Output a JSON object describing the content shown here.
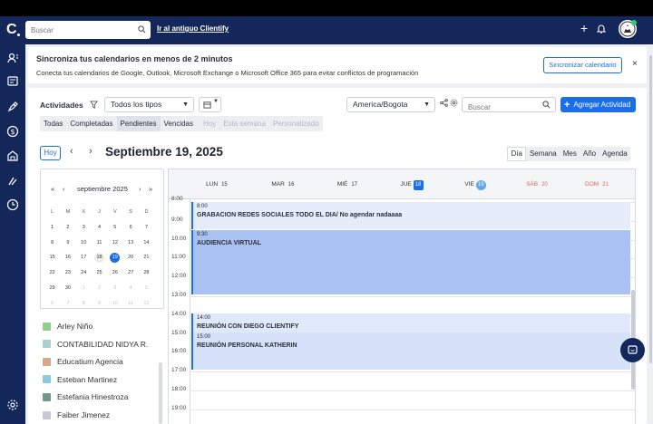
{
  "topnav": {
    "search_placeholder": "Buscar",
    "old_link": "Ir al antiguo Clientify"
  },
  "banner": {
    "title": "Sincroniza tus calendarios en menos de 2 minutos",
    "subtitle": "Conecta tus calendarios de Google, Outlook, Microsoft Exchange o Microsoft Office 365 para evitar conflictos de programación",
    "sync_label": "Sincronizar calendario",
    "close_label": "×"
  },
  "toolbar": {
    "activities_label": "Actividades",
    "types_value": "Todos los tipos",
    "tabs": [
      "Todas",
      "Completadas",
      "Pendientes",
      "Vencidas",
      "Hoy",
      "Esta semana",
      "Personalizado"
    ],
    "timezone_value": "America/Bogota",
    "search_placeholder": "Buscar",
    "add_label": "Agregar Actividad"
  },
  "calendar": {
    "today_label": "Hoy",
    "current_date": "Septiembre 19, 2025",
    "views": [
      "Día",
      "Semana",
      "Mes",
      "Año",
      "Agenda"
    ],
    "selected_view": "Día"
  },
  "mini_calendar": {
    "month_label": "septiembre 2025",
    "nav": [
      "«",
      "‹",
      "›",
      "»"
    ],
    "weekdays": [
      "L",
      "M",
      "X",
      "J",
      "V",
      "S",
      "D"
    ],
    "weeks": [
      [
        "1",
        "2",
        "3",
        "4",
        "5",
        "6",
        "7"
      ],
      [
        "8",
        "9",
        "10",
        "11",
        "12",
        "13",
        "14"
      ],
      [
        "15",
        "16",
        "17",
        "18",
        "19",
        "20",
        "21"
      ],
      [
        "22",
        "23",
        "24",
        "25",
        "26",
        "27",
        "28"
      ],
      [
        "29",
        "30",
        "1",
        "2",
        "3",
        "4",
        "5"
      ],
      [
        "6",
        "7",
        "8",
        "9",
        "10",
        "11",
        "12"
      ]
    ],
    "selected_day": "19"
  },
  "users": [
    {
      "name": "Arley Niño",
      "color": "#8fd08a"
    },
    {
      "name": "CONTABILIDAD NIDYA R.",
      "color": "#a9cfd0"
    },
    {
      "name": "Educatium Agencia",
      "color": "#dba58c"
    },
    {
      "name": "Esteban Martinez",
      "color": "#8fc7e0"
    },
    {
      "name": "Estefania Hinestroza",
      "color": "#6f9a86"
    },
    {
      "name": "Faiber Jimenez",
      "color": "#c7c9d6"
    }
  ],
  "week_header": [
    {
      "label": "LUN",
      "num": "15"
    },
    {
      "label": "MAR",
      "num": "16"
    },
    {
      "label": "MIÉ",
      "num": "17"
    },
    {
      "label": "JUE",
      "num": "18"
    },
    {
      "label": "VIE",
      "num": "19"
    },
    {
      "label": "SÁB",
      "num": "20"
    },
    {
      "label": "DOM",
      "num": "21"
    }
  ],
  "time_labels": [
    "8:00",
    "9:00",
    "10:00",
    "11:00",
    "12:00",
    "13:00",
    "14:00",
    "15:00",
    "16:00",
    "17:00",
    "18:00",
    "19:00"
  ],
  "events": [
    {
      "time": "8:00",
      "title": "GRABACION REDES SOCIALES TODO EL DIA/ No agendar nadaaaa",
      "color": "#e5ecfb"
    },
    {
      "time": "9:30",
      "title": "AUDIENCIA VIRTUAL",
      "color": "#a9c2f1"
    },
    {
      "time": "14:00",
      "title": "REUNIÓN CON DIEGO CLIENTIFY",
      "color": "#e0e9fb"
    },
    {
      "time": "15:00",
      "title": "REUNIÓN PERSONAL KATHERIN",
      "color": "#d5e2f9"
    }
  ]
}
